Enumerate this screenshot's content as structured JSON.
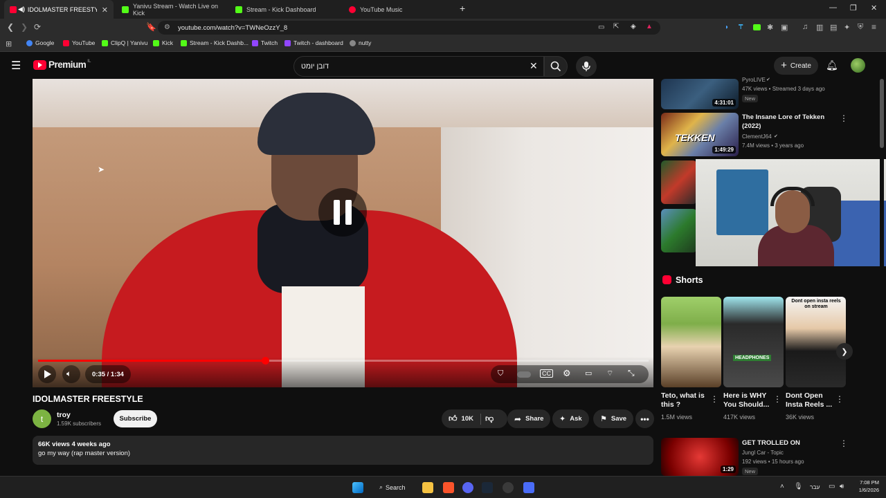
{
  "browser": {
    "tabs": [
      {
        "title": "IDOLMASTER FREESTYLE - Yo",
        "active": true,
        "color": "#ff0033"
      },
      {
        "title": "Yanivu Stream - Watch Live on Kick",
        "active": false,
        "color": "#53fc18"
      },
      {
        "title": "Stream - Kick Dashboard",
        "active": false,
        "color": "#53fc18"
      },
      {
        "title": "YouTube Music",
        "active": false,
        "color": "#ff0033"
      }
    ],
    "new_tab_icon": "plus-icon",
    "url": "youtube.com/watch?v=TWNeOzzY_8",
    "bookmarks": [
      {
        "label": "Google",
        "color": "#4285f4"
      },
      {
        "label": "YouTube",
        "color": "#ff0033"
      },
      {
        "label": "ClipQ | Yanivu",
        "color": "#53fc18"
      },
      {
        "label": "Kick",
        "color": "#53fc18"
      },
      {
        "label": "Stream - Kick Dashb...",
        "color": "#53fc18"
      },
      {
        "label": "Twitch",
        "color": "#9146ff"
      },
      {
        "label": "Twitch - dashboard",
        "color": "#9146ff"
      },
      {
        "label": "nutty",
        "color": "#888888"
      }
    ]
  },
  "youtube": {
    "logo_text": "Premium",
    "logo_suffix": "IL",
    "search_value": "דובן יומט",
    "create_label": "Create",
    "video": {
      "time": "0:35 / 1:34",
      "progress": 0.372,
      "title": "IDOLMASTER FREESTYLE",
      "channel": "troy",
      "channel_initial": "t",
      "subscribers": "1.59K subscribers",
      "subscribe_label": "Subscribe",
      "likes": "10K",
      "share_label": "Share",
      "ask_label": "Ask",
      "save_label": "Save",
      "views_date": "66K views  4 weeks ago",
      "description": "go my way (rap master version)"
    },
    "related": [
      {
        "title": "",
        "channel": "PyroLIVE",
        "meta": "47K views • Streamed 3 days ago",
        "duration": "4:31:01",
        "badge": "New"
      },
      {
        "title_line1": "The Insane Lore of Tekken",
        "title_line2": "(2022)",
        "channel": "ClementJ64",
        "meta": "7.4M views • 3 years ago",
        "duration": "1:49:29"
      }
    ],
    "shorts_heading": "Shorts",
    "shorts": [
      {
        "title_line1": "Teto, what is",
        "title_line2": "this ?",
        "views": "1.5M views"
      },
      {
        "title_line1": "Here is WHY",
        "title_line2": "You Should...",
        "views": "417K views",
        "overlay": "HEADPHONES"
      },
      {
        "title_line1": "Dont Open",
        "title_line2": "Insta Reels ...",
        "views": "36K views",
        "overlay": "Dont open insta reels on stream"
      }
    ],
    "bottom_related": {
      "title": "GET TROLLED ON",
      "channel": "Jungl Car - Topic",
      "meta": "192 views • 15 hours ago",
      "badge": "New",
      "duration": "1:29"
    }
  },
  "taskbar": {
    "search_label": "Search",
    "lang": "עבר",
    "time": "7:08 PM",
    "date": "1/6/2026"
  }
}
